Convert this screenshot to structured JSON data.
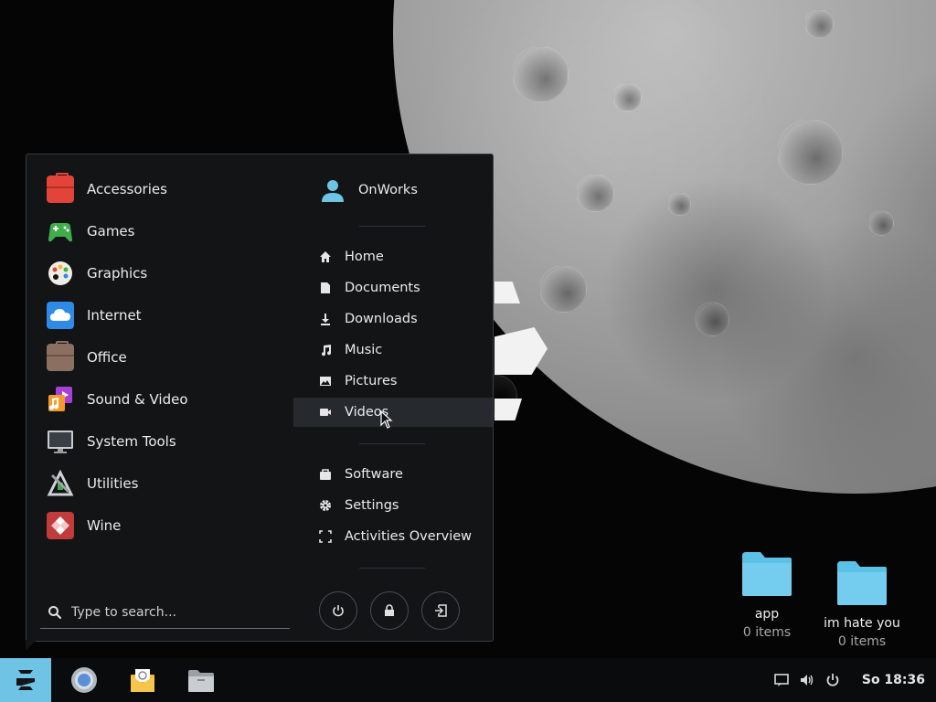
{
  "categories": [
    {
      "label": "Accessories",
      "icon": "toolbox-icon",
      "color": "#e3443a"
    },
    {
      "label": "Games",
      "icon": "gamepad-icon",
      "color": "#3fae4a"
    },
    {
      "label": "Graphics",
      "icon": "palette-icon",
      "color": "#f1ede6"
    },
    {
      "label": "Internet",
      "icon": "cloud-icon",
      "color": "#2e8ae6"
    },
    {
      "label": "Office",
      "icon": "briefcase-icon",
      "color": "#8b7062"
    },
    {
      "label": "Sound & Video",
      "icon": "media-icon",
      "color": "#f59a2b"
    },
    {
      "label": "System Tools",
      "icon": "monitor-icon",
      "color": "#5f646b"
    },
    {
      "label": "Utilities",
      "icon": "utilities-icon",
      "color": "#6b7076"
    },
    {
      "label": "Wine",
      "icon": "wine-icon",
      "color": "#c23b3b"
    }
  ],
  "user": {
    "name": "OnWorks"
  },
  "places": [
    {
      "label": "Home",
      "icon": "home-icon"
    },
    {
      "label": "Documents",
      "icon": "document-icon"
    },
    {
      "label": "Downloads",
      "icon": "download-icon"
    },
    {
      "label": "Music",
      "icon": "music-icon"
    },
    {
      "label": "Pictures",
      "icon": "picture-icon"
    },
    {
      "label": "Videos",
      "icon": "video-icon"
    }
  ],
  "system": [
    {
      "label": "Software",
      "icon": "software-icon"
    },
    {
      "label": "Settings",
      "icon": "gear-icon"
    },
    {
      "label": "Activities Overview",
      "icon": "overview-icon"
    }
  ],
  "search": {
    "placeholder": "Type to search..."
  },
  "taskbar": {
    "clock": "So 18:36"
  },
  "desktop_icons": [
    {
      "name": "app",
      "sub": "0 items"
    },
    {
      "name": "im hate you",
      "sub": "0 items"
    }
  ],
  "colors": {
    "accent": "#6fc3e4",
    "menu_bg": "#121416",
    "folder": "#5cc1e6"
  }
}
